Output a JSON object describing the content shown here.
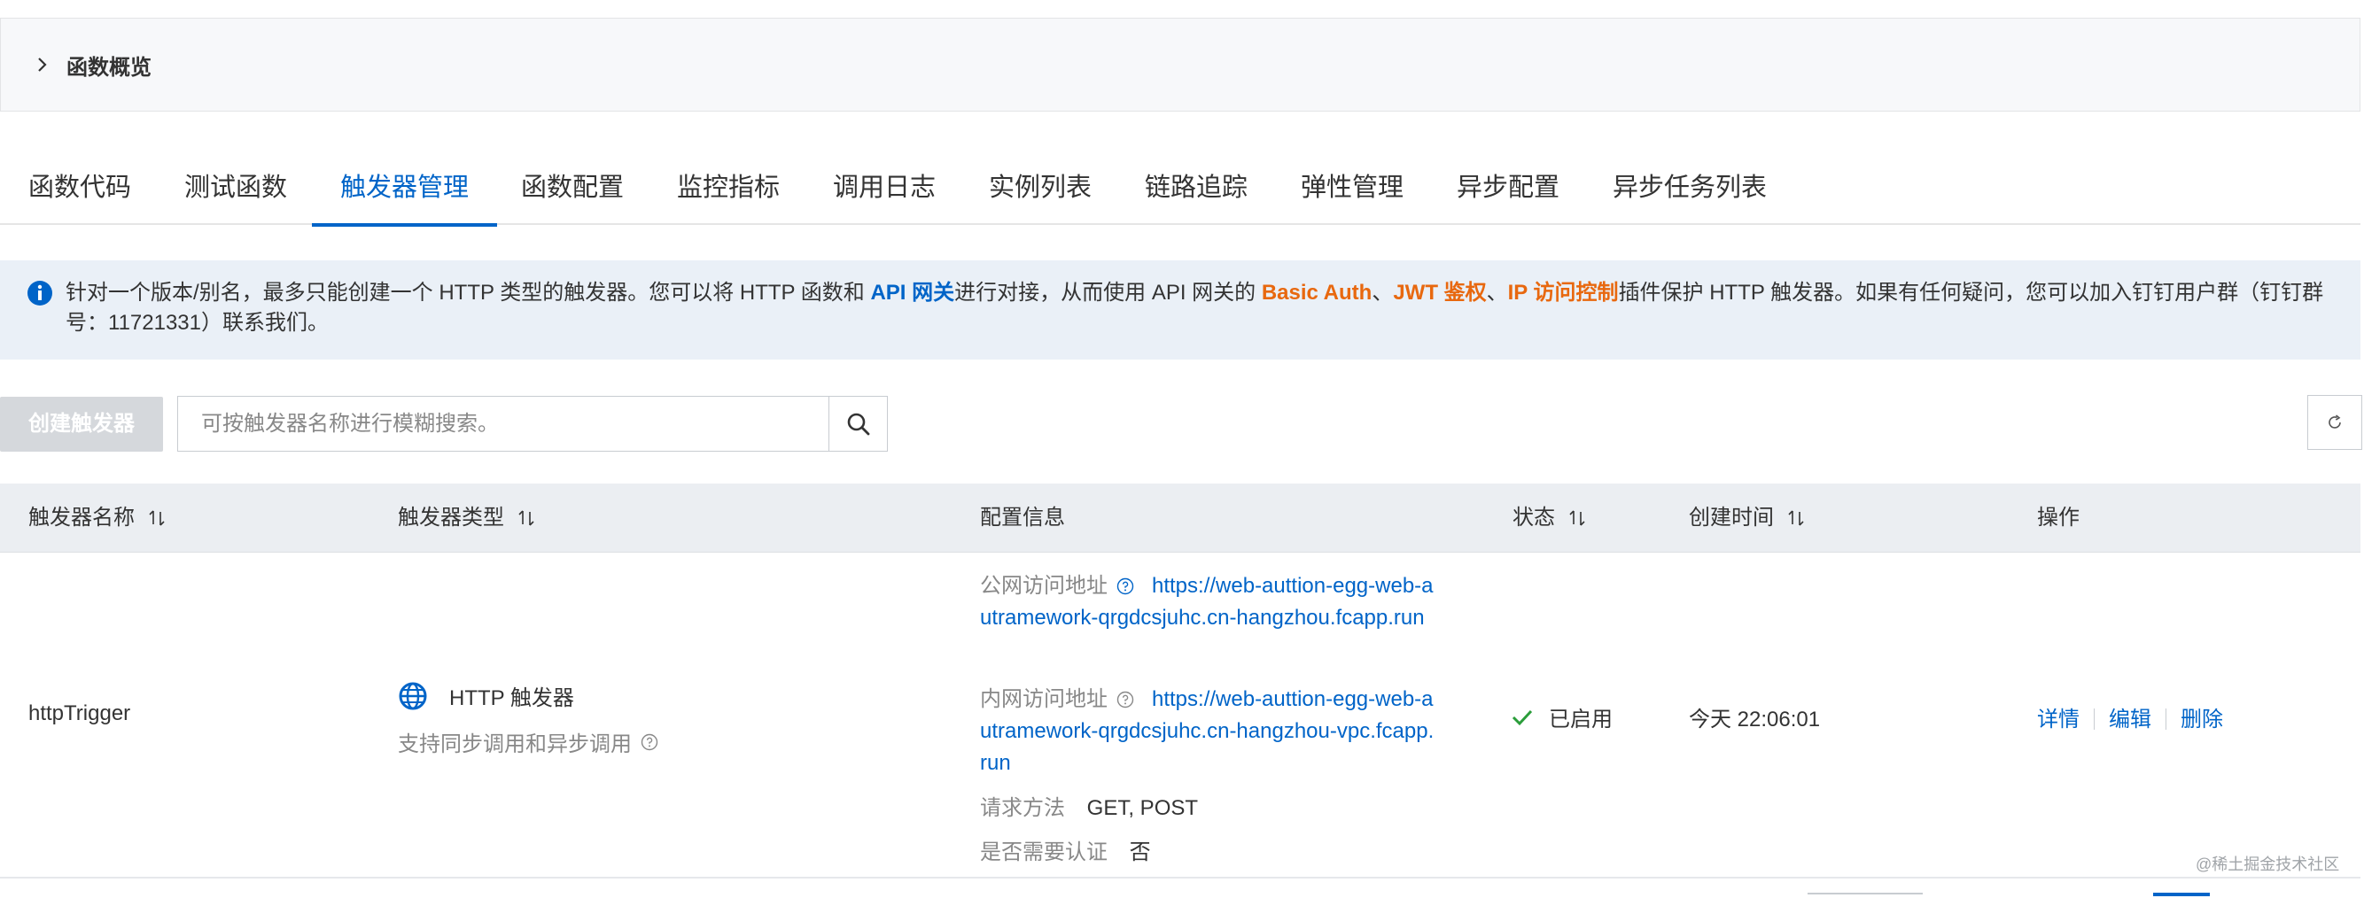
{
  "overview": {
    "title": "函数概览"
  },
  "tabs": [
    {
      "label": "函数代码",
      "active": false
    },
    {
      "label": "测试函数",
      "active": false
    },
    {
      "label": "触发器管理",
      "active": true
    },
    {
      "label": "函数配置",
      "active": false
    },
    {
      "label": "监控指标",
      "active": false
    },
    {
      "label": "调用日志",
      "active": false
    },
    {
      "label": "实例列表",
      "active": false
    },
    {
      "label": "链路追踪",
      "active": false
    },
    {
      "label": "弹性管理",
      "active": false
    },
    {
      "label": "异步配置",
      "active": false
    },
    {
      "label": "异步任务列表",
      "active": false
    }
  ],
  "notice": {
    "part1": "针对一个版本/别名，最多只能创建一个 HTTP 类型的触发器。您可以将 HTTP 函数和 ",
    "api_gateway": "API 网关",
    "part2": "进行对接，从而使用 API 网关的 ",
    "basic_auth": "Basic Auth",
    "sep1": "、",
    "jwt": "JWT 鉴权",
    "sep2": "、",
    "ip_control": "IP 访问控制",
    "part3": "插件保护 HTTP 触发器。如果有任何疑问，您可以加入钉钉用户群（钉钉群号：11721331）联系我们。"
  },
  "toolbar": {
    "create_label": "创建触发器",
    "search_placeholder": "可按触发器名称进行模糊搜索。"
  },
  "table": {
    "headers": {
      "name": "触发器名称",
      "type": "触发器类型",
      "config": "配置信息",
      "status": "状态",
      "created": "创建时间",
      "actions": "操作"
    },
    "rows": [
      {
        "name": "httpTrigger",
        "type_label": "HTTP 触发器",
        "type_desc": "支持同步调用和异步调用",
        "public_label": "公网访问地址",
        "public_url": "https://web-auttion-egg-web-autramework-qrgdcsjuhc.cn-hangzhou.fcapp.run",
        "internal_label": "内网访问地址",
        "internal_url": "https://web-auttion-egg-web-autramework-qrgdcsjuhc.cn-hangzhou-vpc.fcapp.run",
        "method_label": "请求方法",
        "method_value": "GET, POST",
        "auth_label": "是否需要认证",
        "auth_value": "否",
        "status": "已启用",
        "created": "今天 22:06:01",
        "actions": {
          "detail": "详情",
          "edit": "编辑",
          "delete": "删除"
        }
      }
    ]
  },
  "watermark": "@稀土掘金技术社区",
  "colors": {
    "primary": "#0064c8",
    "orange": "#e8680f",
    "success": "#2a9d3a",
    "disabled_button": "#d5d8dc"
  }
}
